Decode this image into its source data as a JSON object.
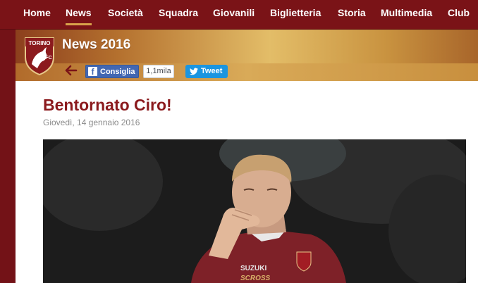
{
  "nav": {
    "items": [
      {
        "label": "Home",
        "active": false
      },
      {
        "label": "News",
        "active": true
      },
      {
        "label": "Società",
        "active": false
      },
      {
        "label": "Squadra",
        "active": false
      },
      {
        "label": "Giovanili",
        "active": false
      },
      {
        "label": "Biglietteria",
        "active": false
      },
      {
        "label": "Storia",
        "active": false
      },
      {
        "label": "Multimedia",
        "active": false
      },
      {
        "label": "Club",
        "active": false
      }
    ]
  },
  "header": {
    "section_title": "News 2016",
    "crest": {
      "top_text": "TORINO",
      "bottom_text": "FC",
      "icon": "bull-crest-icon"
    }
  },
  "social": {
    "facebook_label": "Consiglia",
    "facebook_count": "1,1mila",
    "twitter_label": "Tweet"
  },
  "article": {
    "title": "Bentornato Ciro!",
    "date": "Giovedì, 14 gennaio 2016",
    "photo": {
      "shirt_sponsor_1": "SUZUKI",
      "shirt_sponsor_2": "SCROSS"
    }
  },
  "colors": {
    "brand_maroon": "#7a1317",
    "gold": "#d8a24a",
    "title_red": "#8b1a1d",
    "facebook_blue": "#4267b2",
    "twitter_blue": "#1b95e0"
  }
}
